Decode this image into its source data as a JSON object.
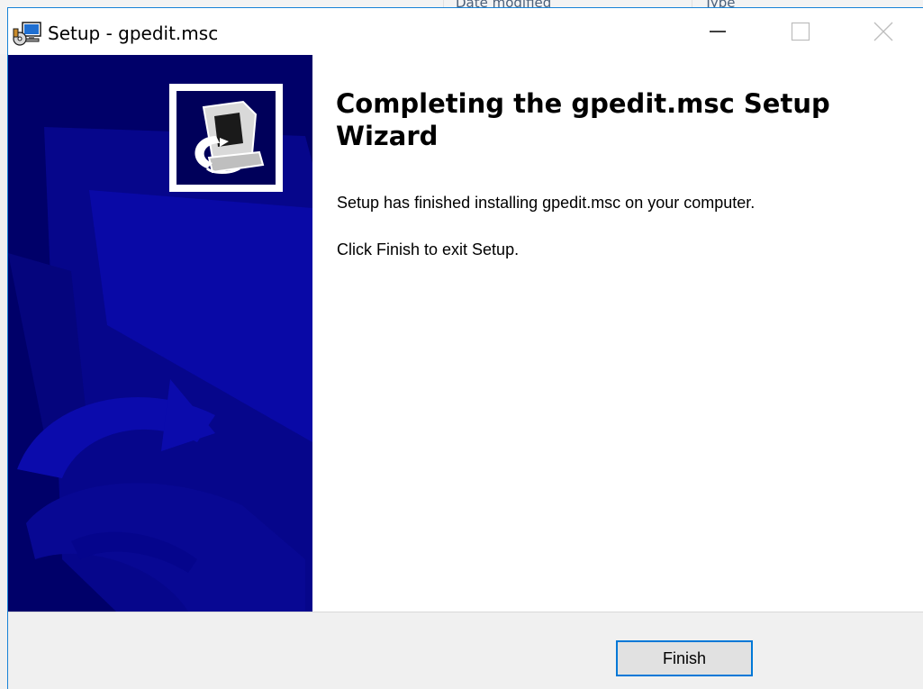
{
  "background_window": {
    "columns": [
      {
        "label": "Date modified"
      },
      {
        "label": "Type"
      }
    ]
  },
  "titlebar": {
    "title": "Setup - gpedit.msc",
    "icon": "setup-installer-icon",
    "minimize": "minimize-icon",
    "maximize": "maximize-icon",
    "close": "close-icon"
  },
  "wizard": {
    "heading": "Completing the gpedit.msc Setup Wizard",
    "message": "Setup has finished installing gpedit.msc on your computer.",
    "instruction": "Click Finish to exit Setup.",
    "logo_icon": "computer-install-icon"
  },
  "footer": {
    "finish_label": "Finish"
  },
  "colors": {
    "banner": "#000080",
    "banner_shape": "#0a0ab0",
    "accent": "#0078d7",
    "footer": "#f0f0f0"
  }
}
